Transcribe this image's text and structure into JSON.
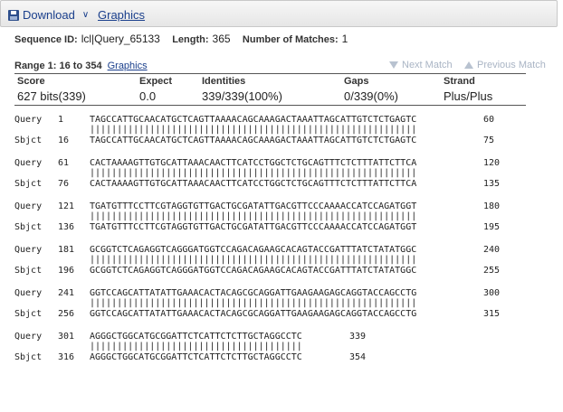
{
  "toolbar": {
    "download_label": "Download",
    "download_icon": "floppy-disk-icon",
    "graphics_label": "Graphics"
  },
  "seqinfo": {
    "id_label": "Sequence ID:",
    "id_value": "lcl|Query_65133",
    "length_label": "Length:",
    "length_value": "365",
    "matches_label": "Number of Matches:",
    "matches_value": "1"
  },
  "range": {
    "label": "Range 1: 16 to 354",
    "graphics_link": "Graphics",
    "next_match": "Next Match",
    "previous_match": "Previous Match"
  },
  "stats": {
    "headers": [
      "Score",
      "Expect",
      "Identities",
      "Gaps",
      "Strand"
    ],
    "values": [
      "627 bits(339)",
      "0.0",
      "339/339(100%)",
      "0/339(0%)",
      "Plus/Plus"
    ]
  },
  "alignment": [
    {
      "q_label": "Query",
      "q_start": "1",
      "q_seq": "TAGCCATTGCAACATGCTCAGTTAAAACAGCAAAGACTAAATTAGCATTGTCTCTGAGTC",
      "q_end": "60",
      "match": "||||||||||||||||||||||||||||||||||||||||||||||||||||||||||||",
      "s_label": "Sbjct",
      "s_start": "16",
      "s_seq": "TAGCCATTGCAACATGCTCAGTTAAAACAGCAAAGACTAAATTAGCATTGTCTCTGAGTC",
      "s_end": "75"
    },
    {
      "q_label": "Query",
      "q_start": "61",
      "q_seq": "CACTAAAAGTTGTGCATTAAACAACTTCATCCTGGCTCTGCAGTTTCTCTTTATTCTTCA",
      "q_end": "120",
      "match": "||||||||||||||||||||||||||||||||||||||||||||||||||||||||||||",
      "s_label": "Sbjct",
      "s_start": "76",
      "s_seq": "CACTAAAAGTTGTGCATTAAACAACTTCATCCTGGCTCTGCAGTTTCTCTTTATTCTTCA",
      "s_end": "135"
    },
    {
      "q_label": "Query",
      "q_start": "121",
      "q_seq": "TGATGTTTCCTTCGTAGGTGTTGACTGCGATATTGACGTTCCCAAAACCATCCAGATGGT",
      "q_end": "180",
      "match": "||||||||||||||||||||||||||||||||||||||||||||||||||||||||||||",
      "s_label": "Sbjct",
      "s_start": "136",
      "s_seq": "TGATGTTTCCTTCGTAGGTGTTGACTGCGATATTGACGTTCCCAAAACCATCCAGATGGT",
      "s_end": "195"
    },
    {
      "q_label": "Query",
      "q_start": "181",
      "q_seq": "GCGGTCTCAGAGGTCAGGGATGGTCCAGACAGAAGCACAGTACCGATTTATCTATATGGC",
      "q_end": "240",
      "match": "||||||||||||||||||||||||||||||||||||||||||||||||||||||||||||",
      "s_label": "Sbjct",
      "s_start": "196",
      "s_seq": "GCGGTCTCAGAGGTCAGGGATGGTCCAGACAGAAGCACAGTACCGATTTATCTATATGGC",
      "s_end": "255"
    },
    {
      "q_label": "Query",
      "q_start": "241",
      "q_seq": "GGTCCAGCATTATATTGAAACACTACAGCGCAGGATTGAAGAAGAGCAGGTACCAGCCTG",
      "q_end": "300",
      "match": "||||||||||||||||||||||||||||||||||||||||||||||||||||||||||||",
      "s_label": "Sbjct",
      "s_start": "256",
      "s_seq": "GGTCCAGCATTATATTGAAACACTACAGCGCAGGATTGAAGAAGAGCAGGTACCAGCCTG",
      "s_end": "315"
    },
    {
      "q_label": "Query",
      "q_start": "301",
      "q_seq": "AGGGCTGGCATGCGGATTCTCATTCTCTTGCTAGGCCTC",
      "q_end": "339",
      "match": "|||||||||||||||||||||||||||||||||||||||",
      "s_label": "Sbjct",
      "s_start": "316",
      "s_seq": "AGGGCTGGCATGCGGATTCTCATTCTCTTGCTAGGCCTC",
      "s_end": "354"
    }
  ]
}
